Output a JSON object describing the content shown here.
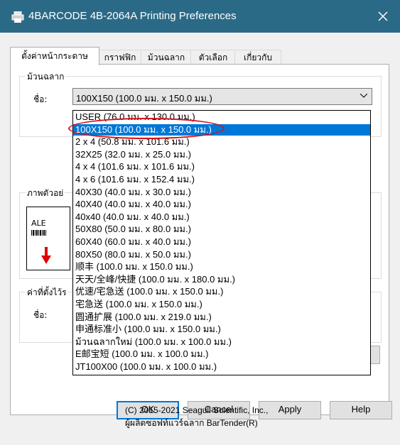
{
  "window": {
    "title": "4BARCODE 4B-2064A Printing Preferences",
    "close_label": "✕"
  },
  "tabs": [
    {
      "label": "ตั้งค่าหน้ากระดาษ",
      "active": true
    },
    {
      "label": "กราฟฟิก",
      "active": false
    },
    {
      "label": "ม้วนฉลาก",
      "active": false
    },
    {
      "label": "ตัวเลือก",
      "active": false
    },
    {
      "label": "เกี่ยวกับ",
      "active": false
    }
  ],
  "stock_group": {
    "label": "ม้วนฉลาก",
    "name_label": "ชื่อ:",
    "selected_value": "100X150 (100.0 มม. x 150.0 มม.)"
  },
  "preview_group": {
    "label": "ภาพตัวอย่",
    "sample_text": "ALE"
  },
  "settings_group": {
    "label": "ค่าที่ตั้งไว้ร",
    "name_label": "ชื่อ:"
  },
  "dropdown": {
    "items": [
      "USER (76.0 มม. x 130.0 มม.)",
      "100X150 (100.0 มม. x 150.0 มม.)",
      "2 x 4 (50.8 มม. x 101.6 มม.)",
      "32X25 (32.0 มม. x 25.0 มม.)",
      "4 x 4 (101.6 มม. x 101.6 มม.)",
      "4 x 6 (101.6 มม. x 152.4 มม.)",
      "40X30 (40.0 มม. x 30.0 มม.)",
      "40X40 (40.0 มม. x 40.0 มม.)",
      "40x40 (40.0 มม. x 40.0 มม.)",
      "50X80 (50.0 มม. x 80.0 มม.)",
      "60X40 (60.0 มม. x 40.0 มม.)",
      "80X50 (80.0 มม. x 50.0 มม.)",
      "顺丰 (100.0 มม. x 150.0 มม.)",
      "天天/全峰/快捷 (100.0 มม. x 180.0 มม.)",
      "优速/宅急送 (100.0 มม. x 150.0 มม.)",
      "宅急送 (100.0 มม. x 150.0 มม.)",
      "圆通扩展 (100.0 มม. x 219.0 มม.)",
      "申通标准小 (100.0 มม. x 150.0 มม.)",
      "ม้วนฉลากใหม่ (100.0 มม. x 100.0 มม.)",
      "E邮宝短 (100.0 มม. x 100.0 มม.)",
      "JT100X00 (100.0 มม. x 100.0 มม.)"
    ],
    "selected_index": 1
  },
  "about": {
    "copyright": "(C) 2015-2021 Seagull Scientific, Inc.,",
    "maker": "ผู้ผลิตซอฟท์แวร์ฉลาก BarTender(R)"
  },
  "buttons": {
    "ok": "OK",
    "cancel": "Cancel",
    "apply": "Apply",
    "help": "Help"
  },
  "colors": {
    "titlebar": "#2b6a86",
    "selection": "#0078d7",
    "annotation": "#d3121b"
  }
}
